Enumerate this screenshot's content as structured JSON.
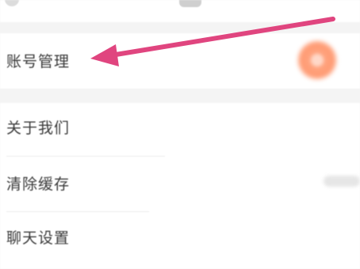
{
  "settings": {
    "items": [
      {
        "label": "账号管理"
      },
      {
        "label": "关于我们"
      },
      {
        "label": "清除缓存"
      },
      {
        "label": "聊天设置"
      }
    ]
  },
  "annotation": {
    "arrow_color": "#e0457f"
  }
}
